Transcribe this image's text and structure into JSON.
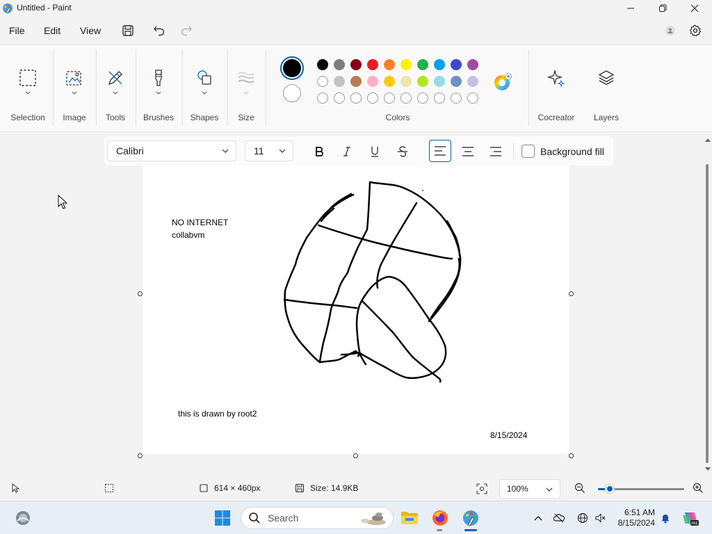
{
  "window": {
    "title": "Untitled - Paint"
  },
  "menu": {
    "file": "File",
    "edit": "Edit",
    "view": "View"
  },
  "ribbon": {
    "groups": {
      "selection": "Selection",
      "image": "Image",
      "tools": "Tools",
      "brushes": "Brushes",
      "shapes": "Shapes",
      "size": "Size",
      "colors": "Colors",
      "cocreator": "Cocreator",
      "layers": "Layers"
    },
    "primary_color": "#000000",
    "secondary_color": "#ffffff",
    "palette_row1": [
      "#000000",
      "#7f7f7f",
      "#880015",
      "#ed1c24",
      "#ff7f27",
      "#fff200",
      "#22b14c",
      "#00a2e8",
      "#3f48cc",
      "#a349a4"
    ],
    "palette_row2": [
      "#ffffff",
      "#c3c3c3",
      "#b97a57",
      "#ffaec9",
      "#ffc90e",
      "#efe4b0",
      "#b5e61d",
      "#99d9ea",
      "#7092be",
      "#c8bfe7"
    ],
    "palette_row3_count": 10
  },
  "text_toolbar": {
    "font": "Calibri",
    "size": "11",
    "background_fill": "Background fill"
  },
  "canvas": {
    "text1_line1": "NO INTERNET",
    "text1_line2": "collabvm",
    "text2": "this is drawn by root2",
    "text3": "8/15/2024"
  },
  "status": {
    "dimensions": "614 × 460px",
    "size": "Size: 14.9KB",
    "zoom": "100%",
    "zoom_level": 0.14
  },
  "taskbar": {
    "search_placeholder": "Search",
    "time": "6:51 AM",
    "date": "8/15/2024"
  },
  "colors": {
    "accent": "#005fb8"
  }
}
